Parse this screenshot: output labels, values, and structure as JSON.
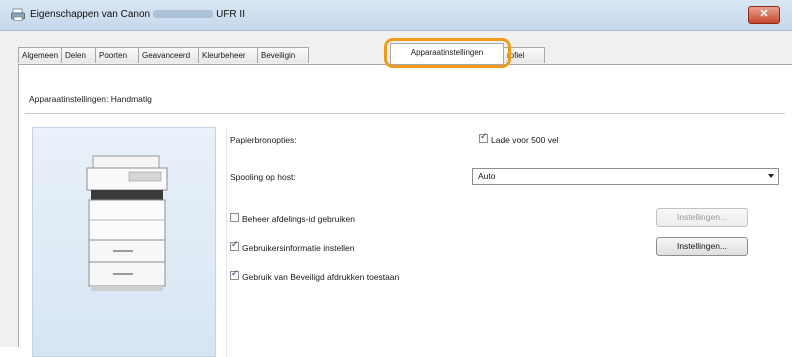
{
  "window": {
    "title_prefix": "Eigenschappen van Canon",
    "title_suffix": "UFR II",
    "close_label": "✕"
  },
  "tabs": [
    {
      "label": "Algemeen"
    },
    {
      "label": "Delen"
    },
    {
      "label": "Poorten"
    },
    {
      "label": "Geavanceerd"
    },
    {
      "label": "Kleurbeheer"
    },
    {
      "label": "Beveiligin"
    },
    {
      "label": "Apparaatinstellingen"
    },
    {
      "label": "rofiel"
    }
  ],
  "active_tab": "Apparaatinstellingen",
  "settings_mode_label": "Apparaatinstellingen: Handmatig",
  "paper_source": {
    "label": "Papierbronopties:",
    "option_label": "Lade voor 500 vel",
    "checked": true
  },
  "spooling": {
    "label": "Spooling op host:",
    "value": "Auto"
  },
  "options": [
    {
      "label": "Beheer afdelings-id gebruiken",
      "checked": false,
      "button": "Instellingen...",
      "button_enabled": false
    },
    {
      "label": "Gebruikersinformatie instellen",
      "checked": true,
      "button": "Instellingen...",
      "button_enabled": true
    },
    {
      "label": "Gebruik van Beveiligd afdrukken toestaan",
      "checked": true
    }
  ],
  "colors": {
    "highlight": "#f19b1d",
    "close_button": "#c8462d"
  }
}
